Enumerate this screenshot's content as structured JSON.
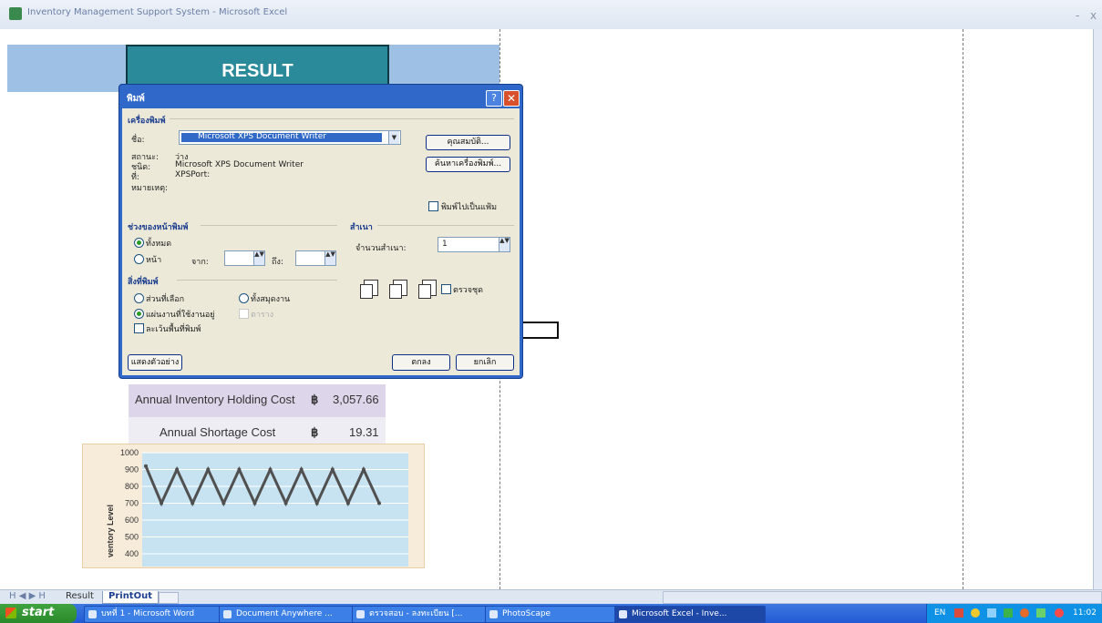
{
  "window": {
    "title": "Inventory Management Support System - Microsoft Excel",
    "controls": [
      "-",
      "x"
    ]
  },
  "sheet": {
    "result_header": "RESULT",
    "rows": [
      {
        "label": "Annual Inventory Holding Cost",
        "currency": "฿",
        "value": "3,057.66"
      },
      {
        "label": "Annual Shortage Cost",
        "currency": "฿",
        "value": "19.31"
      }
    ]
  },
  "chart_data": {
    "type": "line",
    "ylabel": "ventory Level",
    "yticks": [
      "1000",
      "900",
      "800",
      "700",
      "600",
      "500",
      "400"
    ],
    "ylim": [
      400,
      1000
    ],
    "series": [
      {
        "values": [
          920,
          700,
          900,
          700,
          900,
          700,
          900,
          700,
          900,
          700,
          900,
          700,
          900,
          700,
          900,
          700
        ]
      }
    ],
    "colors": {
      "line": "#505050",
      "plot_bg": "#c7e3f1",
      "frame_bg": "#f7ebd9"
    }
  },
  "dialog": {
    "title": "พิมพ์",
    "help_label": "?",
    "close_label": "✕",
    "printer_group": "เครื่องพิมพ์",
    "name_label": "ชื่อ:",
    "printer_name": "Microsoft XPS Document Writer",
    "status_label": "สถานะ:",
    "status_value": "ว่าง",
    "type_label": "ชนิด:",
    "type_value": "Microsoft XPS Document Writer",
    "where_label": "ที่:",
    "where_value": "XPSPort:",
    "comment_label": "หมายเหตุ:",
    "properties_button": "คุณสมบัติ...",
    "find_printer_button": "ค้นหาเครื่องพิมพ์...",
    "print_to_file": "พิมพ์ไปเป็นแฟ้ม",
    "range_group": "ช่วงของหน้าพิมพ์",
    "range_all": "ทั้งหมด",
    "range_pages": "หน้า",
    "from_label": "จาก:",
    "to_label": "ถึง:",
    "copies_group": "สำเนา",
    "copies_label": "จำนวนสำเนา:",
    "copies_value": "1",
    "collate": "ตรวจชุด",
    "print_what_group": "สิ่งที่พิมพ์",
    "selection": "ส่วนที่เลือก",
    "entire_workbook": "ทั้งสมุดงาน",
    "active_sheets": "แผ่นงานที่ใช้งานอยู่",
    "table_option": "ตาราง",
    "ignore_print_areas": "ละเว้นพื้นที่พิมพ์",
    "preview_button": "แสดงตัวอย่าง",
    "ok_button": "ตกลง",
    "cancel_button": "ยกเลิก"
  },
  "tabs": {
    "nav": "H ◀ ▶ H",
    "items": [
      "Result",
      "PrintOut"
    ]
  },
  "taskbar": {
    "start": "start",
    "tasks": [
      "บทที่ 1 - Microsoft Word",
      "Document Anywhere ...",
      "ตรวจสอบ - ลงทะเบียน [...",
      "PhotoScape",
      "Microsoft Excel - Inve..."
    ],
    "tray_lang": "EN",
    "clock": "11:02"
  }
}
